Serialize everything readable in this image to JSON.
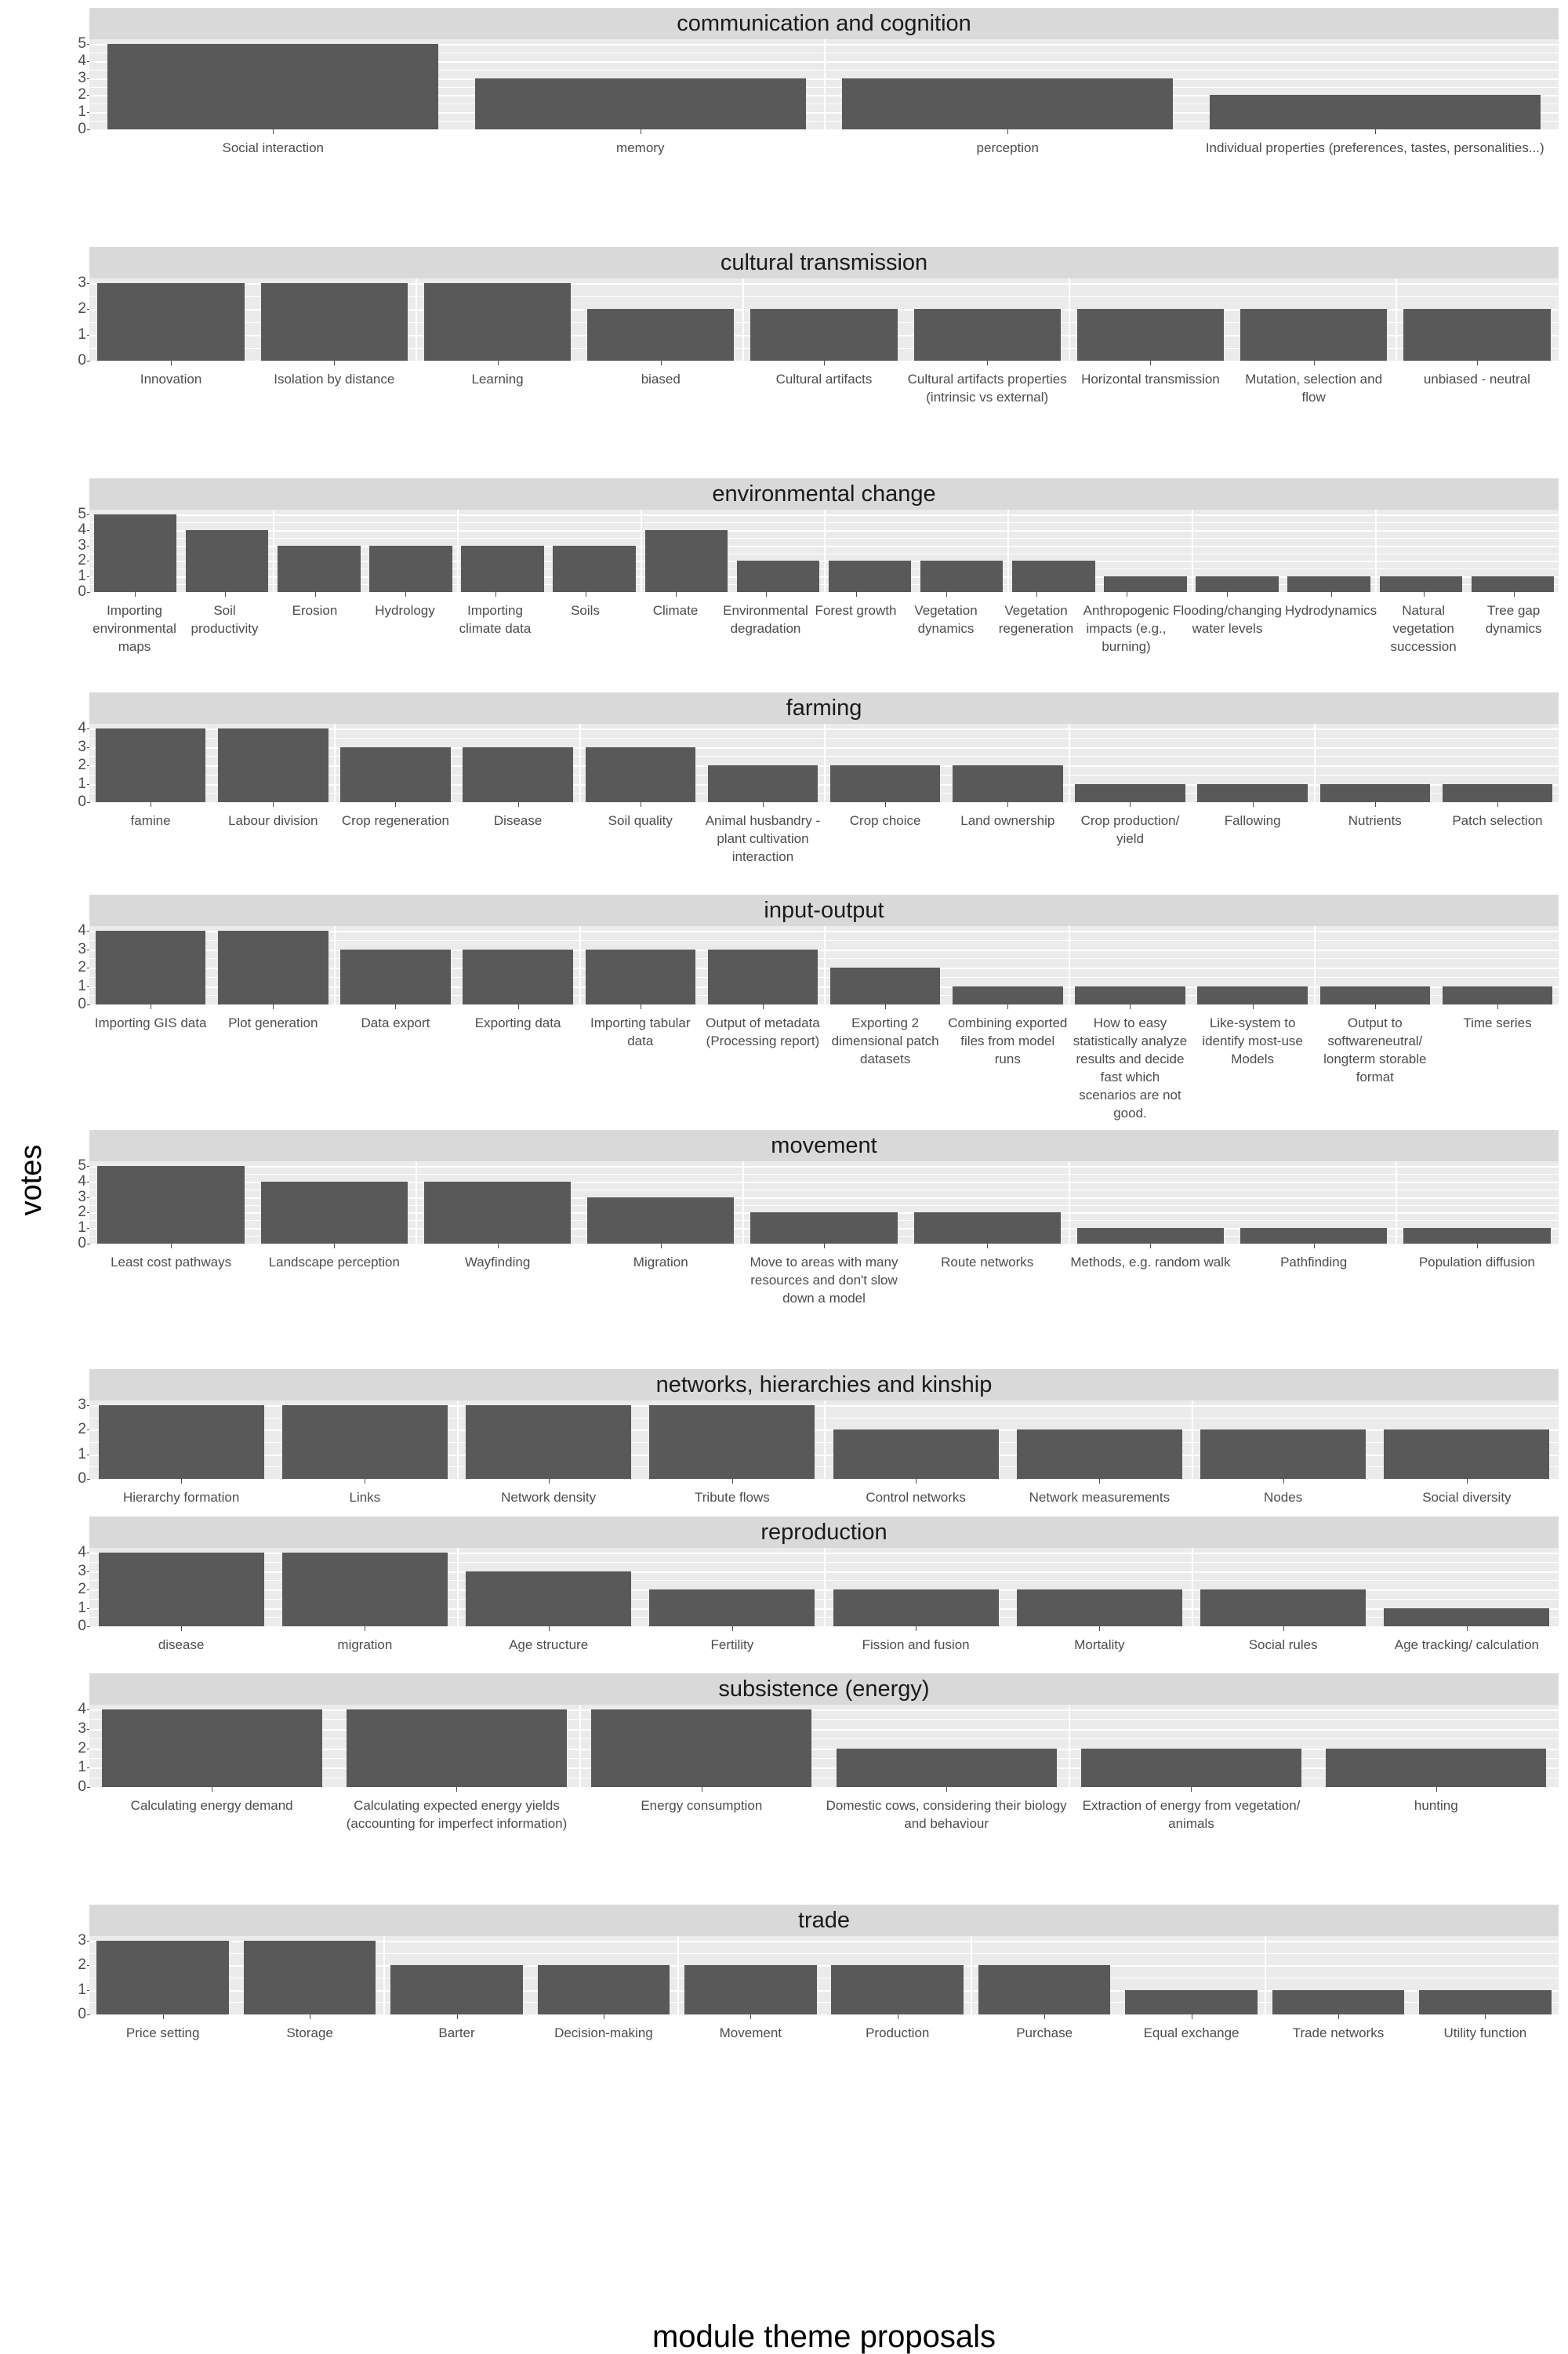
{
  "axis": {
    "ylabel": "votes",
    "xlabel": "module theme proposals"
  },
  "style": {
    "bar_color": "#595959",
    "panel_background": "#ebebeb",
    "strip_background": "#d9d9d9",
    "grid_color": "#ffffff",
    "tick_text_color": "#4d4d4d"
  },
  "chart_data": {
    "type": "bar",
    "title": "",
    "subtitle": "",
    "xlabel": "module theme proposals",
    "ylabel": "votes",
    "grid": true,
    "legend": "none",
    "orientation": "vertical",
    "facet_layout": "rows",
    "facets": [
      {
        "name": "communication and cognition",
        "ylim": [
          0,
          5
        ],
        "yticks": [
          0,
          1,
          2,
          3,
          4,
          5
        ],
        "categories": [
          "Social interaction",
          "memory",
          "perception",
          "Individual properties (preferences, tastes, personalities...)"
        ],
        "values": [
          5,
          3,
          3,
          2
        ]
      },
      {
        "name": "cultural transmission",
        "ylim": [
          0,
          3
        ],
        "yticks": [
          0,
          1,
          2,
          3
        ],
        "categories": [
          "Innovation",
          "Isolation by distance",
          "Learning",
          "biased",
          "Cultural artifacts",
          "Cultural artifacts properties (intrinsic vs external)",
          "Horizontal transmission",
          "Mutation, selection and flow",
          "unbiased - neutral"
        ],
        "values": [
          3,
          3,
          3,
          2,
          2,
          2,
          2,
          2,
          2
        ]
      },
      {
        "name": "environmental change",
        "ylim": [
          0,
          5
        ],
        "yticks": [
          0,
          1,
          2,
          3,
          4,
          5
        ],
        "categories": [
          "Importing environmental maps",
          "Soil productivity",
          "Erosion",
          "Hydrology",
          "Importing climate data",
          "Soils",
          "Climate",
          "Environmental degradation",
          "Forest growth",
          "Vegetation dynamics",
          "Vegetation regeneration",
          "Anthropogenic impacts (e.g., burning)",
          "Flooding/changing water levels",
          "Hydrodynamics",
          "Natural vegetation succession",
          "Tree gap dynamics"
        ],
        "values": [
          5,
          4,
          3,
          3,
          3,
          3,
          4,
          2,
          2,
          2,
          2,
          1,
          1,
          1,
          1,
          1
        ]
      },
      {
        "name": "farming",
        "ylim": [
          0,
          4
        ],
        "yticks": [
          0,
          1,
          2,
          3,
          4
        ],
        "categories": [
          "famine",
          "Labour division",
          "Crop regeneration",
          "Disease",
          "Soil quality",
          "Animal husbandry - plant cultivation interaction",
          "Crop choice",
          "Land ownership",
          "Crop production/ yield",
          "Fallowing",
          "Nutrients",
          "Patch selection"
        ],
        "values": [
          4,
          4,
          3,
          3,
          3,
          2,
          2,
          2,
          1,
          1,
          1,
          1
        ]
      },
      {
        "name": "input-output",
        "ylim": [
          0,
          4
        ],
        "yticks": [
          0,
          1,
          2,
          3,
          4
        ],
        "categories": [
          "Importing GIS data",
          "Plot generation",
          "Data export",
          "Exporting data",
          "Importing tabular data",
          "Output of metadata (Processing report)",
          "Exporting 2 dimensional patch datasets",
          "Combining exported files from model runs",
          "How to easy statistically analyze results and decide fast which scenarios are not good.",
          "Like-system to identify most-use Models",
          "Output to softwareneutral/ longterm storable format",
          "Time series"
        ],
        "values": [
          4,
          4,
          3,
          3,
          3,
          3,
          2,
          1,
          1,
          1,
          1,
          1
        ]
      },
      {
        "name": "movement",
        "ylim": [
          0,
          5
        ],
        "yticks": [
          0,
          1,
          2,
          3,
          4,
          5
        ],
        "categories": [
          "Least cost pathways",
          "Landscape perception",
          "Wayfinding",
          "Migration",
          "Move to areas with many resources and don't slow down a model",
          "Route networks",
          "Methods, e.g. random walk",
          "Pathfinding",
          "Population diffusion"
        ],
        "values": [
          5,
          4,
          4,
          3,
          2,
          2,
          1,
          1,
          1
        ]
      },
      {
        "name": "networks, hierarchies and kinship",
        "ylim": [
          0,
          3
        ],
        "yticks": [
          0,
          1,
          2,
          3
        ],
        "categories": [
          "Hierarchy formation",
          "Links",
          "Network density",
          "Tribute flows",
          "Control networks",
          "Network measurements",
          "Nodes",
          "Social diversity"
        ],
        "values": [
          3,
          3,
          3,
          3,
          2,
          2,
          2,
          2
        ]
      },
      {
        "name": "reproduction",
        "ylim": [
          0,
          4
        ],
        "yticks": [
          0,
          1,
          2,
          3,
          4
        ],
        "categories": [
          "disease",
          "migration",
          "Age structure",
          "Fertility",
          "Fission and fusion",
          "Mortality",
          "Social rules",
          "Age tracking/ calculation"
        ],
        "values": [
          4,
          4,
          3,
          2,
          2,
          2,
          2,
          1
        ]
      },
      {
        "name": "subsistence (energy)",
        "ylim": [
          0,
          4
        ],
        "yticks": [
          0,
          1,
          2,
          3,
          4
        ],
        "categories": [
          "Calculating energy demand",
          "Calculating expected energy yields (accounting for imperfect information)",
          "Energy consumption",
          "Domestic cows, considering their biology and behaviour",
          "Extraction of energy from vegetation/ animals",
          "hunting"
        ],
        "values": [
          4,
          4,
          4,
          2,
          2,
          2
        ]
      },
      {
        "name": "trade",
        "ylim": [
          0,
          3
        ],
        "yticks": [
          0,
          1,
          2,
          3
        ],
        "categories": [
          "Price setting",
          "Storage",
          "Barter",
          "Decision-making",
          "Movement",
          "Production",
          "Purchase",
          "Equal exchange",
          "Trade networks",
          "Utility function"
        ],
        "values": [
          3,
          3,
          2,
          2,
          2,
          2,
          2,
          1,
          1,
          1
        ]
      }
    ]
  }
}
